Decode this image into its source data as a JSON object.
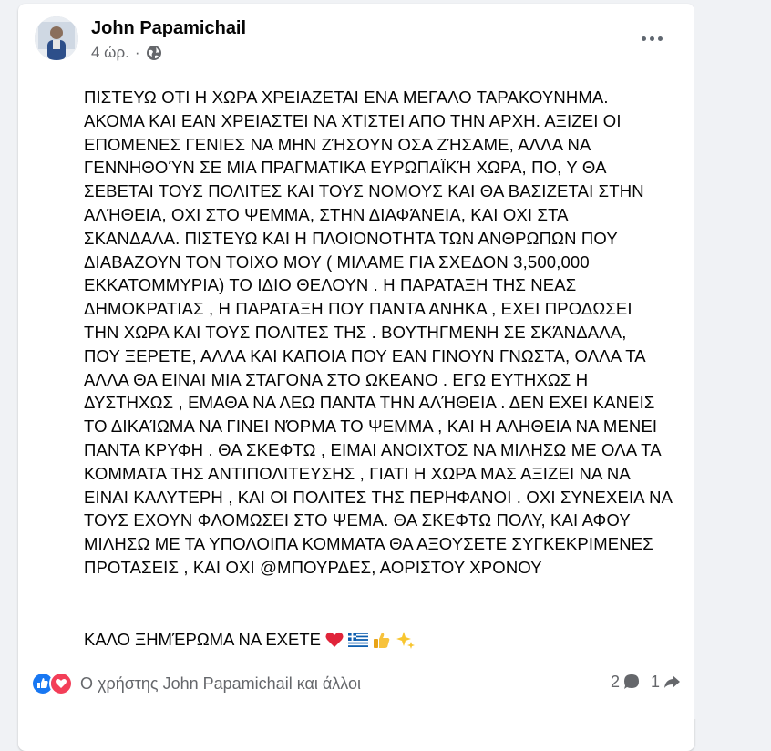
{
  "post": {
    "author": "John Papamichail",
    "time": "4 ώρ.",
    "separator": "·",
    "privacy_icon": "globe-icon",
    "more_icon": "more-options-icon",
    "text": "ΠΙΣΤΕΥΩ ΟΤΙ Η ΧΩΡΑ ΧΡΕΙΑΖΕΤΑΙ ΕΝΑ ΜΕΓΑΛΟ ΤΑΡΑΚΟΥΝΗΜΑ.\nΑΚΟΜΑ ΚΑΙ ΕΑΝ ΧΡΕΙΑΣΤΕΙ ΝΑ ΧΤΙΣΤΕΙ ΑΠΟ ΤΗΝ ΑΡΧΗ.  ΑΞΙΖΕΙ ΟΙ\nΕΠΟΜΕΝΕΣ ΓΕΝΙΕΣ ΝΑ ΜΗΝ ΖΉΣΟΥΝ ΟΣΑ ΖΉΣΑΜΕ,  ΑΛΛΑ ΝΑ\nΓΕΝΝΗΘΟΎΝ ΣΕ ΜΙΑ ΠΡΑΓΜΑΤΙΚΑ ΕΥΡΩΠΑΪΚΉ ΧΩΡΑ, ΠΟ, Υ ΘΑ\nΣΕΒΕΤΑΙ ΤΟΥΣ ΠΟΛΙΤΕΣ ΚΑΙ ΤΟΥΣ ΝΟΜΟΥΣ ΚΑΙ  ΘΑ ΒΑΣΙΖΕΤΑΙ ΣΤΗΝ\nΑΛΉΘΕΙΑ,  ΟΧΙ ΣΤΟ ΨΕΜΜΑ,  ΣΤΗΝ ΔΙΑΦΆΝΕΙΑ,  ΚΑΙ ΟΧΙ ΣΤΑ\nΣΚΑΝΔΑΛΑ. ΠΙΣΤΕΥΩ ΚΑΙ Η ΠΛΟΙΟΝΟΤΗΤΑ ΤΩΝ ΑΝΘΡΩΠΩΝ ΠΟΥ\nΔΙΑΒΑΖΟΥΝ ΤΟΝ ΤΟΙΧΟ ΜΟΥ  ( ΜΙΛΑΜΕ ΓΙΑ ΣΧΕΔΟΝ 3,500,000\nΕΚΚΑΤΟΜΜΥΡΙΑ) ΤΟ ΙΔΙΟ ΘΕΛΟΥΝ . Η ΠΑΡΑΤΑΞΗ ΤΗΣ ΝΕΑΣ\nΔΗΜΟΚΡΑΤΙΑΣ , Η ΠΑΡΑΤΑΞΗ ΠΟΥ ΠΑΝΤΑ ΑΝΗΚΑ , ΕΧΕΙ ΠΡΟΔΩΣΕΙ\nΤΗΝ ΧΩΡΑ ΚΑΙ ΤΟΥΣ ΠΟΛΙΤΕΣ ΤΗΣ . ΒΟΥΤΗΓΜΕΝΗ ΣΕ ΣΚΆΝΔΑΛΑ,\nΠΟΥ ΞΕΡΕΤΕ, ΑΛΛΑ ΚΑΙ ΚΑΠΟΙΑ  ΠΟΥ ΕΑΝ ΓΙΝΟΥΝ ΓΝΩΣΤΑ, ΟΛΛΑ ΤΑ\nΑΛΛΑ  ΘΑ ΕΙΝΑΙ ΜΙΑ ΣΤΑΓΟΝΑ ΣΤΟ ΩΚΕΑΝΟ . ΕΓΩ ΕΥΤΗΧΩΣ Η\nΔΥΣΤΗΧΩΣ , ΕΜΑΘΑ ΝΑ ΛΕΩ ΠΑΝΤΑ ΤΗΝ ΑΛΉΘΕΙΑ . ΔΕΝ ΕΧΕΙ ΚΑΝΕΙΣ\nΤΟ ΔΙΚΑΊΩΜΑ ΝΑ ΓΙΝΕΙ ΝΌΡΜΑ ΤΟ ΨΕΜΜΑ , ΚΑΙ Η ΑΛΗΘΕΙΑ ΝΑ ΜΕΝΕΙ\nΠΑΝΤΑ ΚΡΥΦΗ . ΘΑ ΣΚΕΦΤΩ , ΕΙΜΑΙ ΑΝΟΙΧΤΟΣ ΝΑ ΜΙΛΗΣΩ ΜΕ ΟΛΑ ΤΑ\nΚΟΜΜΑΤΑ ΤΗΣ ΑΝΤΙΠΟΛΙΤΕΥΣΗΣ , ΓΙΑΤΙ Η ΧΩΡΑ ΜΑΣ ΑΞΙΖΕΙ ΝΑ ΝΑ\nΕΙΝΑΙ ΚΑΛΥΤΕΡΗ , ΚΑΙ ΟΙ ΠΟΛΙΤΕΣ ΤΗΣ ΠΕΡΗΦΑΝΟΙ . ΟΧΙ ΣΥΝΕΧΕΙΑ ΝΑ\nΤΟΥΣ ΕΧΟΥΝ ΦΛΟΜΩΣΕΙ ΣΤΟ ΨΕΜΑ.  ΘΑ ΣΚΕΦΤΩ ΠΟΛΥ,  ΚΑΙ ΑΦΟΥ\nΜΙΛΗΣΩ ΜΕ ΤΑ ΥΠΟΛΟΙΠΑ ΚΟΜΜΑΤΑ  ΘΑ ΑΞΟΥΣΕΤΕ ΣΥΓΚΕΚΡΙΜΕΝΕΣ\nΠΡΟΤΑΣΕΙΣ , ΚΑΙ ΟΧΙ @ΜΠΟΥΡΔΕΣ,  ΑΟΡΙΣΤΟΥ ΧΡΟΝΟΥ",
    "closing": "ΚΑΛΟ ΞΗΜΈΡΩΜΑ ΝΑ ΕΧΕΤΕ",
    "closing_emojis": [
      "heart-emoji",
      "greek-flag-emoji",
      "thumbs-up-emoji",
      "sparkles-emoji"
    ]
  },
  "reactions": {
    "icons": [
      "like-reaction-icon",
      "love-reaction-icon"
    ],
    "text": "Ο χρήστης John Papamichail και άλλοι",
    "comments_count": "2",
    "shares_count": "1"
  },
  "colors": {
    "like_blue": "#1877f2",
    "love_red": "#f33e58",
    "meta_gray": "#65676b"
  }
}
